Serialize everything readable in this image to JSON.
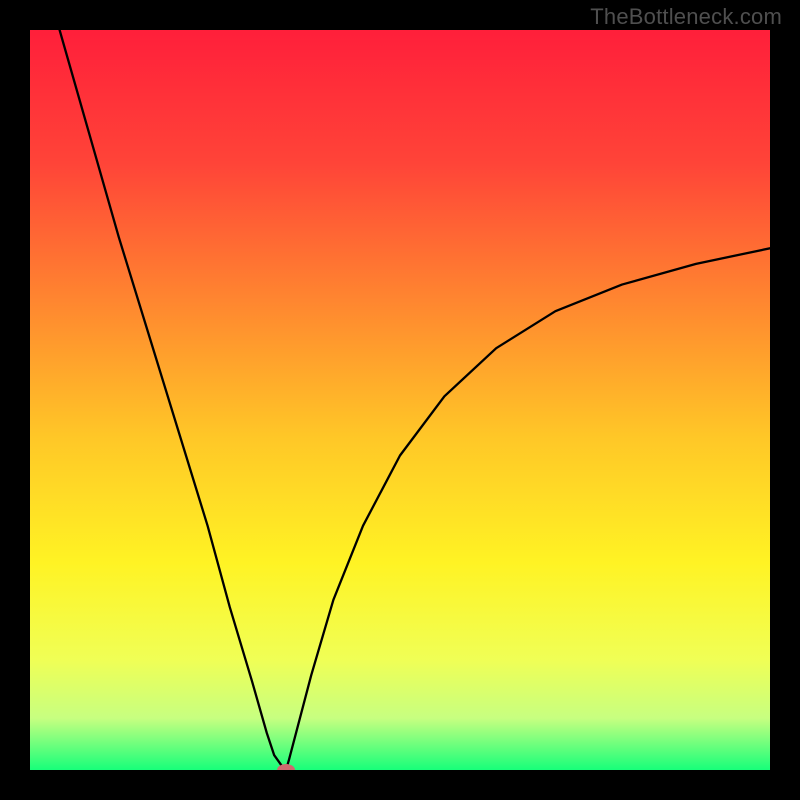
{
  "watermark": "TheBottleneck.com",
  "chart_data": {
    "type": "line",
    "title": "",
    "xlabel": "",
    "ylabel": "",
    "xlim": [
      0,
      100
    ],
    "ylim": [
      0,
      100
    ],
    "grid": false,
    "legend": false,
    "background_gradient": {
      "stops": [
        {
          "offset": 0.0,
          "color": "#ff1f3a"
        },
        {
          "offset": 0.18,
          "color": "#ff4438"
        },
        {
          "offset": 0.38,
          "color": "#ff8b2f"
        },
        {
          "offset": 0.55,
          "color": "#ffc727"
        },
        {
          "offset": 0.72,
          "color": "#fff324"
        },
        {
          "offset": 0.85,
          "color": "#f0ff55"
        },
        {
          "offset": 0.93,
          "color": "#c7ff80"
        },
        {
          "offset": 1.0,
          "color": "#17ff7a"
        }
      ]
    },
    "series": [
      {
        "name": "bottleneck-curve",
        "color": "#000000",
        "width": 2.3,
        "x": [
          4,
          8,
          12,
          16,
          20,
          24,
          27,
          30,
          32,
          33,
          34,
          34.6,
          35,
          36,
          38,
          41,
          45,
          50,
          56,
          63,
          71,
          80,
          90,
          100
        ],
        "y": [
          100,
          86,
          72,
          59,
          46,
          33,
          22,
          12,
          5,
          2,
          0.6,
          0,
          1.4,
          5.2,
          12.8,
          23,
          33,
          42.5,
          50.5,
          57,
          62,
          65.6,
          68.4,
          70.5
        ]
      }
    ],
    "marker": {
      "name": "optimum-point",
      "x": 34.6,
      "y": 0,
      "color": "#cf6a6f",
      "rx": 9,
      "ry": 6
    }
  }
}
